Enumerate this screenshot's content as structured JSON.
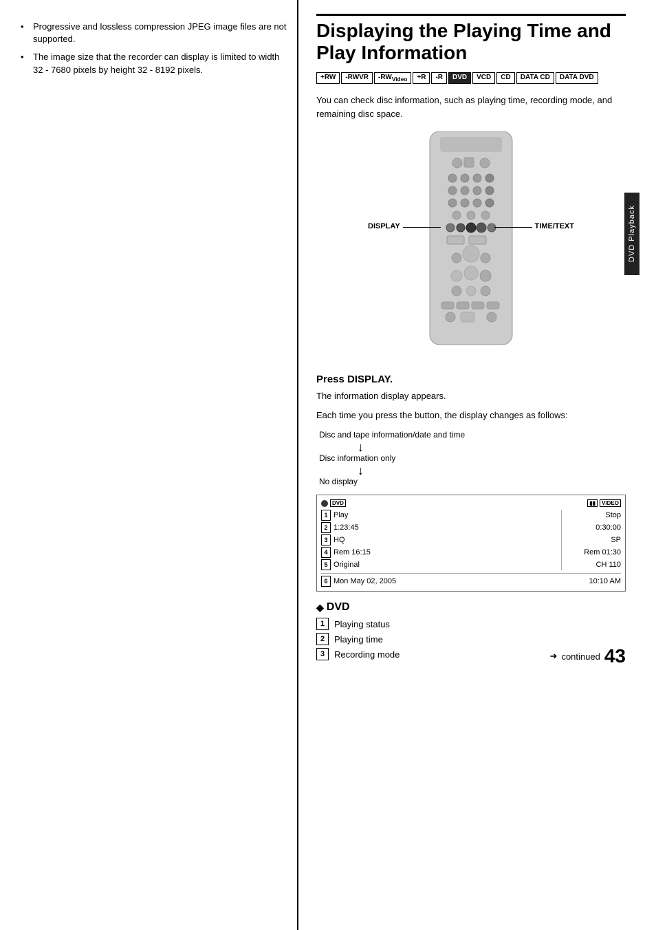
{
  "left": {
    "bullets": [
      "Progressive and lossless compression JPEG image files are not supported.",
      "The image size that the recorder can display is limited to width 32 - 7680 pixels by height 32 - 8192 pixels."
    ]
  },
  "right": {
    "title": "Displaying the Playing Time and Play Information",
    "badges_row1": [
      "+RW",
      "-RWVR",
      "-RWVideo",
      "+R",
      "-R",
      "DVD"
    ],
    "badges_row2": [
      "VCD",
      "CD",
      "DATA CD",
      "DATA DVD"
    ],
    "desc": "You can check disc information, such as playing time, recording mode, and remaining disc space.",
    "remote_label_left": "DISPLAY",
    "remote_label_right": "TIME/TEXT",
    "press_title": "Press DISPLAY.",
    "press_desc1": "The information display appears.",
    "press_desc2": "Each time you press the button, the display changes as follows:",
    "flow": [
      {
        "text": "Disc and tape information/date and time",
        "arrow": true
      },
      {
        "text": "Disc information only",
        "arrow": true
      },
      {
        "text": "No display",
        "arrow": false
      }
    ],
    "infobox": {
      "dvd_icon": "DVD",
      "vhs_icon": "VIDEO",
      "rows_left": [
        {
          "num": "1",
          "val": "Play"
        },
        {
          "num": "2",
          "val": "1:23:45"
        },
        {
          "num": "3",
          "val": "HQ"
        },
        {
          "num": "4",
          "val": "Rem 16:15"
        },
        {
          "num": "5",
          "val": "Original"
        }
      ],
      "rows_right": [
        {
          "val": "Stop"
        },
        {
          "val": "0:30:00"
        },
        {
          "val": "SP"
        },
        {
          "val": "Rem 01:30"
        },
        {
          "val": "CH 110"
        }
      ],
      "date_num": "6",
      "date_val": "Mon May 02, 2005",
      "date_time": "10:10 AM"
    },
    "dvd_section": {
      "title": "DVD",
      "items": [
        {
          "num": "1",
          "label": "Playing status"
        },
        {
          "num": "2",
          "label": "Playing time"
        },
        {
          "num": "3",
          "label": "Recording mode"
        }
      ]
    },
    "footer": {
      "continued": "continued",
      "page": "43"
    },
    "side_tab": "DVD Playback"
  }
}
